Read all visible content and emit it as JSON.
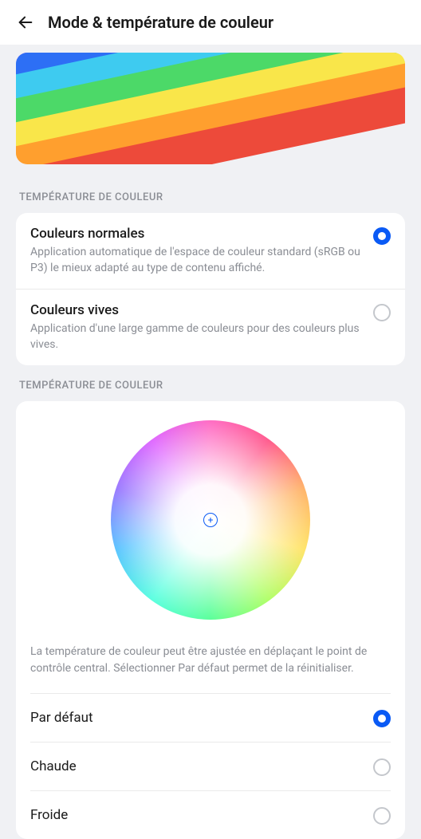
{
  "header": {
    "title": "Mode & température de couleur"
  },
  "section1": {
    "label": "TEMPÉRATURE DE COULEUR",
    "options": [
      {
        "title": "Couleurs normales",
        "desc": "Application automatique de l'espace de couleur standard (sRGB ou P3) le mieux adapté au type de contenu affiché.",
        "selected": true
      },
      {
        "title": "Couleurs vives",
        "desc": "Application d'une large gamme de couleurs pour des couleurs plus vives.",
        "selected": false
      }
    ]
  },
  "section2": {
    "label": "TEMPÉRATURE DE COULEUR",
    "desc": "La température de couleur peut être ajustée en déplaçant le point de contrôle central. Sélectionner Par défaut permet de la réinitialiser.",
    "options": [
      {
        "label": "Par défaut",
        "selected": true
      },
      {
        "label": "Chaude",
        "selected": false
      },
      {
        "label": "Froide",
        "selected": false
      }
    ]
  }
}
